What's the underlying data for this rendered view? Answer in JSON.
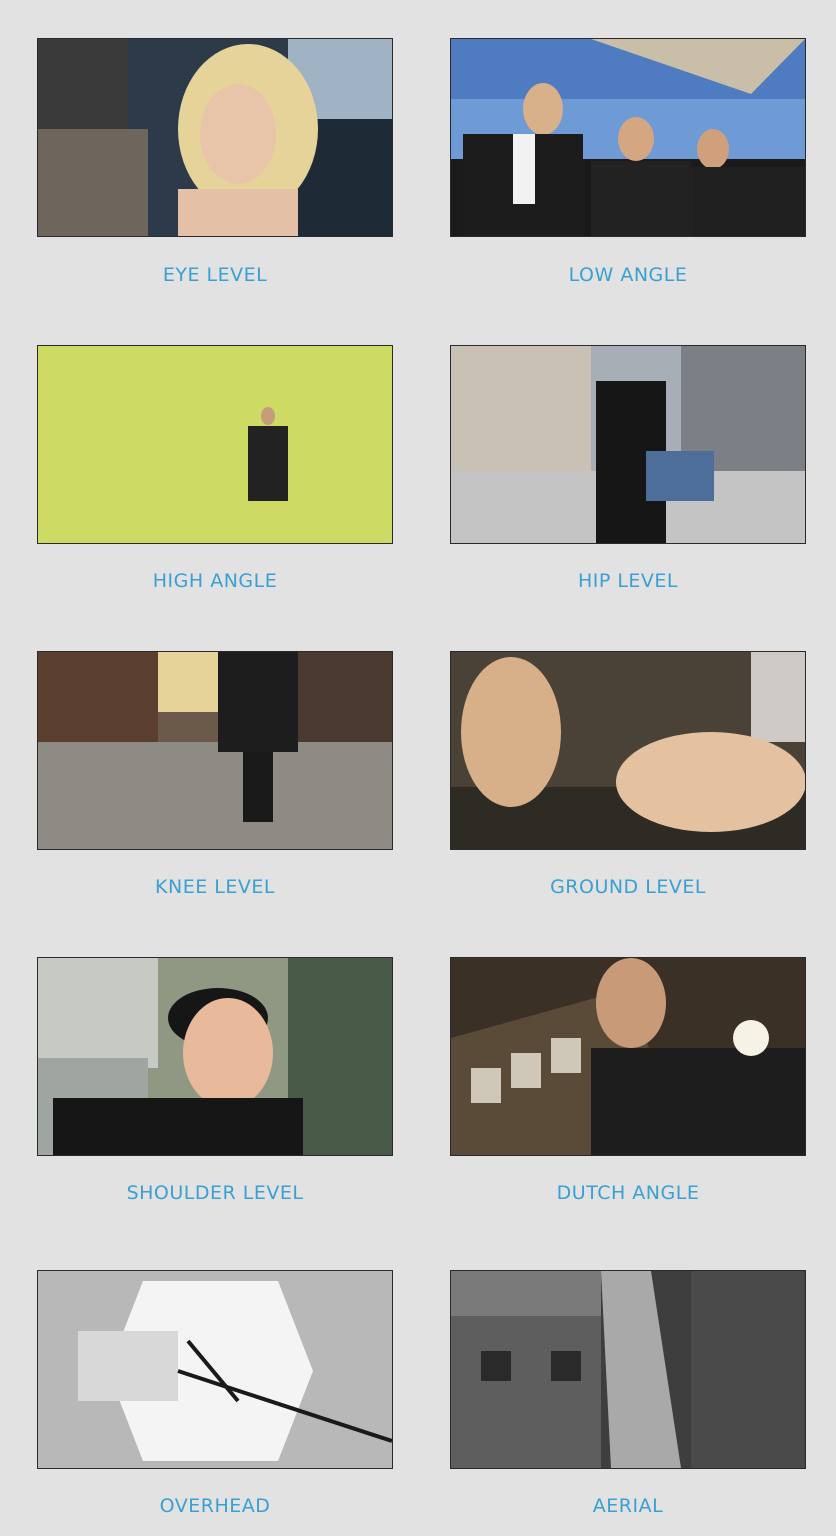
{
  "colors": {
    "background": "#e2e2e2",
    "caption": "#3aa0d3"
  },
  "shots": [
    {
      "label": "EYE LEVEL",
      "image": "woman-blonde-closeup-photo"
    },
    {
      "label": "LOW ANGLE",
      "image": "three-men-suits-from-below-photo"
    },
    {
      "label": "HIGH ANGLE",
      "image": "man-in-yellow-flower-field-photo"
    },
    {
      "label": "HIP LEVEL",
      "image": "man-with-briefcase-city-street-photo"
    },
    {
      "label": "KNEE LEVEL",
      "image": "person-walking-stone-street-photo"
    },
    {
      "label": "GROUND LEVEL",
      "image": "ballet-pointe-shoes-photo"
    },
    {
      "label": "SHOULDER LEVEL",
      "image": "boy-with-glasses-smiling-photo"
    },
    {
      "label": "DUTCH ANGLE",
      "image": "man-shouting-tilted-photo"
    },
    {
      "label": "OVERHEAD",
      "image": "overhead-hallway-figure-photo"
    },
    {
      "label": "AERIAL",
      "image": "black-and-white-city-street-aerial-photo"
    }
  ]
}
